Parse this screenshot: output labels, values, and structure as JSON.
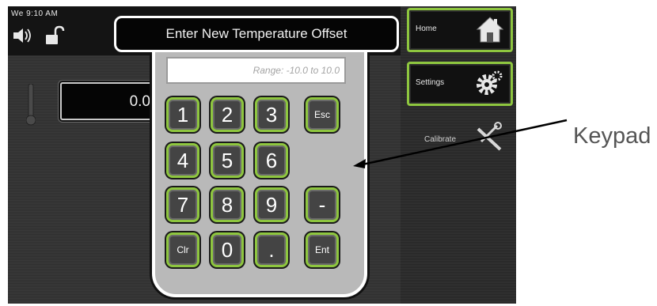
{
  "status": {
    "clock": "We 9:10 AM"
  },
  "main": {
    "value": "0.0"
  },
  "nav": {
    "home_label": "Home",
    "settings_label": "Settings",
    "calibrate_label": "Calibrate"
  },
  "dialog": {
    "title": "Enter New Temperature Offset",
    "range_placeholder": "Range: -10.0 to 10.0",
    "keys": {
      "k1": "1",
      "k2": "2",
      "k3": "3",
      "esc": "Esc",
      "k4": "4",
      "k5": "5",
      "k6": "6",
      "k7": "7",
      "k8": "8",
      "k9": "9",
      "minus": "-",
      "clr": "Clr",
      "k0": "0",
      "dot": ".",
      "ent": "Ent"
    }
  },
  "annotation": {
    "label": "Keypad"
  },
  "colors": {
    "key_border": "#8ec63f",
    "screen_bg": "#333333",
    "dialog_bg": "#b9b9b9"
  }
}
